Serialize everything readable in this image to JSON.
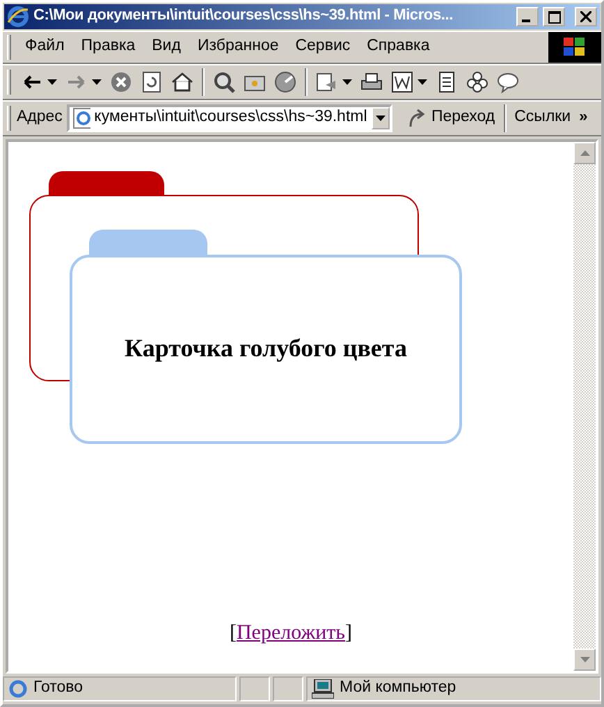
{
  "window": {
    "title": "C:\\Мои документы\\intuit\\courses\\css\\hs~39.html - Micros..."
  },
  "menu": [
    {
      "label": "Файл"
    },
    {
      "label": "Правка"
    },
    {
      "label": "Вид"
    },
    {
      "label": "Избранное"
    },
    {
      "label": "Сервис"
    },
    {
      "label": "Справка"
    }
  ],
  "address_bar": {
    "label": "Адрес",
    "value": "кументы\\intuit\\courses\\css\\hs~39.html",
    "go_button": "Переход",
    "links": "Ссылки",
    "more": "»"
  },
  "cards": [
    {
      "color": "#c00000"
    },
    {
      "color": "#a6c8f0",
      "text": "Карточка голубого цвета"
    }
  ],
  "link": {
    "before": "[",
    "label": "Переложить",
    "after": "]"
  },
  "status_bar": {
    "text": "Готово",
    "zone": "Мой компьютер"
  }
}
